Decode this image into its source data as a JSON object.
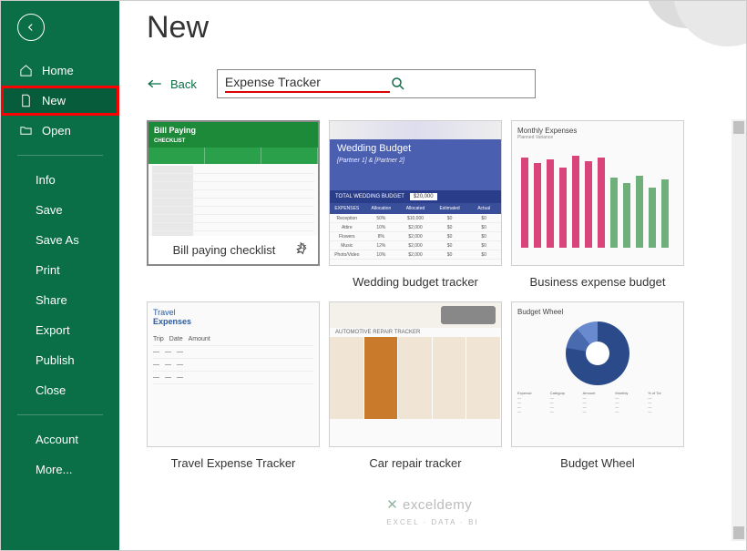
{
  "sidebar": {
    "home": "Home",
    "new": "New",
    "open": "Open",
    "info": "Info",
    "save": "Save",
    "saveas": "Save As",
    "print": "Print",
    "share": "Share",
    "export": "Export",
    "publish": "Publish",
    "close": "Close",
    "account": "Account",
    "more": "More..."
  },
  "page": {
    "title": "New",
    "back": "Back"
  },
  "search": {
    "value": "Expense Tracker"
  },
  "templates": [
    {
      "label": "Bill paying checklist"
    },
    {
      "label": "Wedding budget tracker"
    },
    {
      "label": "Business expense budget"
    },
    {
      "label": "Travel Expense Tracker"
    },
    {
      "label": "Car repair tracker"
    },
    {
      "label": "Budget Wheel"
    }
  ],
  "thumbs": {
    "bill": {
      "title": "Bill Paying",
      "sub": "CHECKLIST"
    },
    "wedding": {
      "title": "Wedding Budget",
      "sub": "[Partner 1] & [Partner 2]",
      "total_label": "TOTAL WEDDING BUDGET",
      "total": "$20,000",
      "exp": "EXPENSES"
    },
    "biz": {
      "title": "Monthly Expenses",
      "legend": "Planned    Variance"
    },
    "travel": {
      "ttl1": "Travel",
      "ttl2": "Expenses"
    },
    "car": {
      "ttl": "AUTOMOTIVE REPAIR TRACKER"
    },
    "wheel": {
      "ttl": "Budget Wheel"
    }
  },
  "watermark": {
    "brand": "exceldemy",
    "sub": "EXCEL · DATA · BI"
  }
}
